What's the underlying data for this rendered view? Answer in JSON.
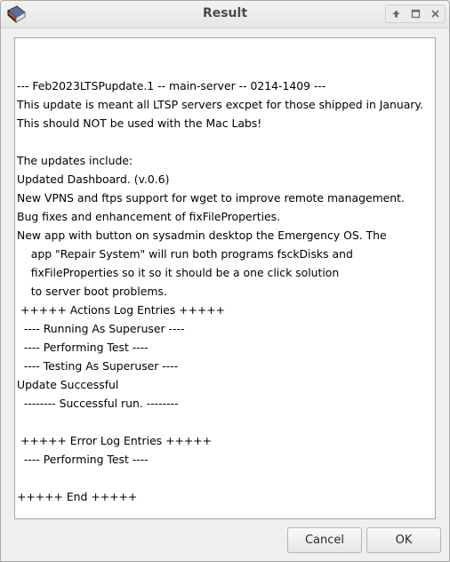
{
  "window": {
    "title": "Result"
  },
  "icons": {
    "app": "book-icon",
    "shade": "up-arrow-icon",
    "maximize": "maximize-icon",
    "close": "close-icon"
  },
  "log_text": {
    "lines": [
      "--- Feb2023LTSPupdate.1 -- main-server -- 0214-1409 ---",
      "This update is meant all LTSP servers excpet for those shipped in January.",
      "This should NOT be used with the Mac Labs!",
      "",
      "The updates include:",
      "Updated Dashboard. (v.0.6)",
      "New VPNS and ftps support for wget to improve remote management.",
      "Bug fixes and enhancement of fixFileProperties.",
      "New app with button on sysadmin desktop the Emergency OS. The",
      "    app \"Repair System\" will run both programs fsckDisks and",
      "    fixFileProperties so it so it should be a one click solution",
      "    to server boot problems.",
      " +++++ Actions Log Entries +++++",
      "  ---- Running As Superuser ----",
      "  ---- Performing Test ----",
      "  ---- Testing As Superuser ----",
      "Update Successful",
      "  -------- Successful run. --------",
      "",
      " +++++ Error Log Entries +++++",
      "  ---- Performing Test ----",
      "",
      "+++++ End +++++"
    ]
  },
  "buttons": {
    "cancel": "Cancel",
    "ok": "OK"
  }
}
